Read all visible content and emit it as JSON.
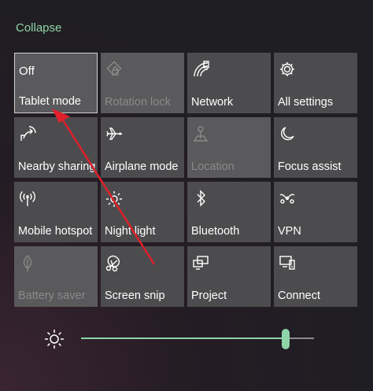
{
  "panel": {
    "collapse_label": "Collapse"
  },
  "tiles": {
    "tablet_mode": {
      "state": "Off",
      "label": "Tablet mode",
      "icon": "tablet-mode-icon"
    },
    "rotation_lock": {
      "label": "Rotation lock",
      "icon": "rotation-lock-icon"
    },
    "network": {
      "label": "Network",
      "icon": "network-icon"
    },
    "all_settings": {
      "label": "All settings",
      "icon": "gear-icon"
    },
    "nearby_sharing": {
      "label": "Nearby sharing",
      "icon": "share-icon"
    },
    "airplane_mode": {
      "label": "Airplane mode",
      "icon": "airplane-icon"
    },
    "location": {
      "label": "Location",
      "icon": "location-icon"
    },
    "focus_assist": {
      "label": "Focus assist",
      "icon": "moon-icon"
    },
    "mobile_hotspot": {
      "label": "Mobile hotspot",
      "icon": "hotspot-icon"
    },
    "night_light": {
      "label": "Night light",
      "icon": "night-light-icon"
    },
    "bluetooth": {
      "label": "Bluetooth",
      "icon": "bluetooth-icon"
    },
    "vpn": {
      "label": "VPN",
      "icon": "vpn-icon"
    },
    "battery_saver": {
      "label": "Battery saver",
      "icon": "battery-saver-icon"
    },
    "screen_snip": {
      "label": "Screen snip",
      "icon": "screen-snip-icon"
    },
    "project": {
      "label": "Project",
      "icon": "project-icon"
    },
    "connect": {
      "label": "Connect",
      "icon": "connect-icon"
    }
  },
  "brightness": {
    "icon": "brightness-icon",
    "level": 0.88
  },
  "colors": {
    "accent": "#8fd3a8",
    "tile": "#4c4c4e",
    "annotation_arrow": "#e0202a"
  }
}
